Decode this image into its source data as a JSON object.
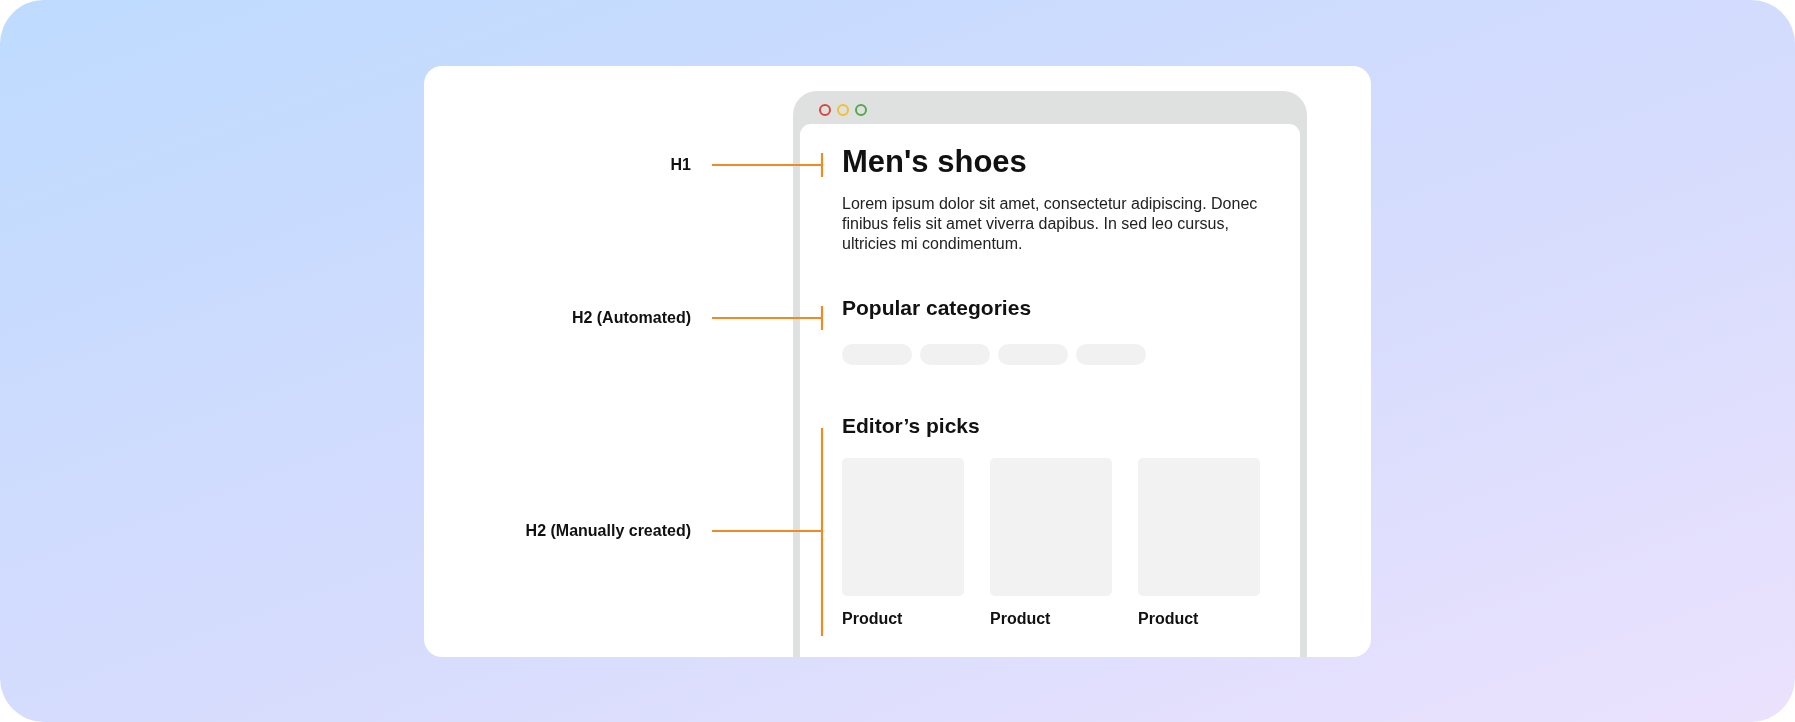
{
  "annotations": [
    {
      "label": "H1"
    },
    {
      "label": "H2 (Automated)"
    },
    {
      "label": "H2 (Manually created)"
    }
  ],
  "page": {
    "title": "Men's shoes",
    "intro": "Lorem ipsum dolor sit amet, consectetur adipiscing. Donec finibus felis sit amet viverra dapibus. In sed leo cursus, ultricies mi condimentum.",
    "categories_heading": "Popular categories",
    "picks_heading": "Editor’s picks",
    "products": [
      {
        "name": "Product"
      },
      {
        "name": "Product"
      },
      {
        "name": "Product"
      }
    ]
  }
}
